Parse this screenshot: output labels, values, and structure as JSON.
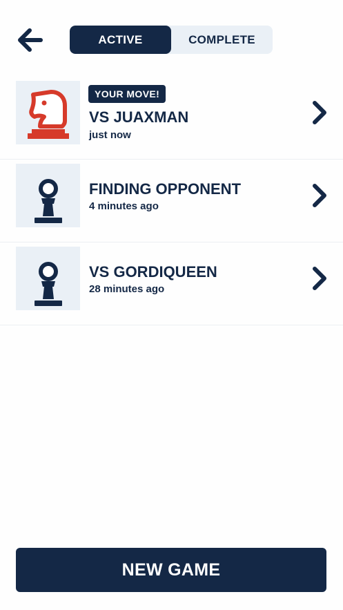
{
  "header": {
    "back_icon": "arrow-left-icon",
    "tabs": [
      {
        "label": "ACTIVE",
        "selected": true
      },
      {
        "label": "COMPLETE",
        "selected": false
      }
    ]
  },
  "games": [
    {
      "badge": "YOUR MOVE!",
      "title": "VS JUAXMAN",
      "time": "just now",
      "piece_icon": "knight-icon",
      "piece_color": "#d63a2a"
    },
    {
      "badge": "",
      "title": "FINDING OPPONENT",
      "time": "4 minutes ago",
      "piece_icon": "pawn-icon",
      "piece_color": "#142846"
    },
    {
      "badge": "",
      "title": "VS GORDIQUEEN",
      "time": "28 minutes ago",
      "piece_icon": "pawn-icon",
      "piece_color": "#142846"
    }
  ],
  "footer": {
    "new_game_label": "NEW GAME"
  },
  "colors": {
    "primary": "#142846",
    "accent_red": "#d63a2a",
    "tab_background": "#eaf0f6"
  }
}
